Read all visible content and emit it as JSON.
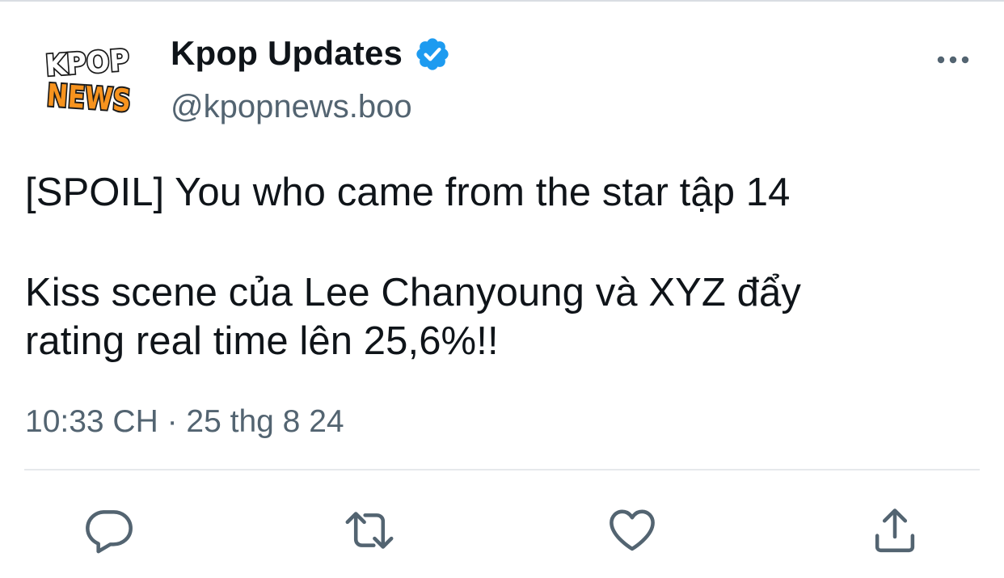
{
  "account": {
    "display_name": "Kpop Updates",
    "handle": "@kpopnews.boo",
    "avatar_text_top": "KPOP",
    "avatar_text_bottom": "NEWS"
  },
  "tweet": {
    "line1": "[SPOIL] You who came from the star tập 14",
    "line2": "Kiss scene của Lee Chanyoung và XYZ đẩy",
    "line3": "rating real time lên 25,6%!!",
    "timestamp": "10:33 CH · 25 thg 8 24"
  },
  "icons": {
    "more": "more-horizontal-icon",
    "verified": "verified-badge-icon",
    "reply": "reply-icon",
    "retweet": "retweet-icon",
    "like": "like-icon",
    "share": "share-icon"
  },
  "colors": {
    "text": "#0f1419",
    "secondary": "#536471",
    "verified_blue": "#1d9bf0",
    "avatar_orange": "#f7931e"
  }
}
